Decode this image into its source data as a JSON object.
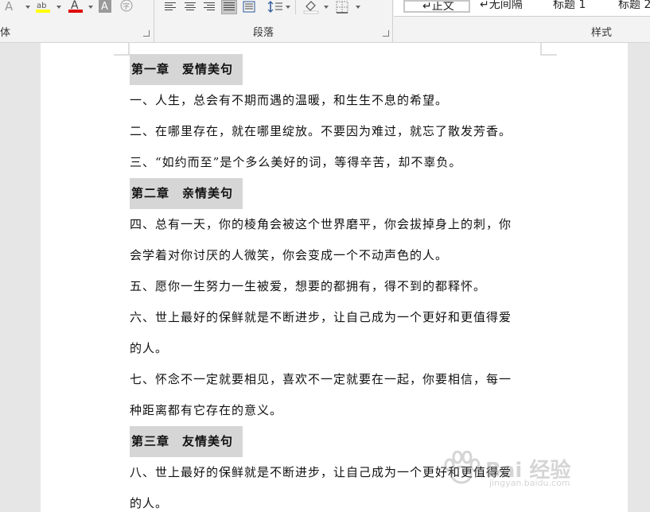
{
  "ribbon": {
    "font_group_label": "体",
    "paragraph_group_label": "段落",
    "styles_group_label": "样式",
    "styles": [
      {
        "label": "↵正文",
        "selected": true
      },
      {
        "label": "↵无间隔",
        "selected": false
      },
      {
        "label": "标题 1",
        "selected": false
      },
      {
        "label": "标题 2",
        "selected": false
      }
    ],
    "colors": {
      "highlight": "#ffff00",
      "font_color": "#e00000",
      "heading_shading": "#d6d6d6"
    }
  },
  "document": {
    "blocks": [
      {
        "type": "heading",
        "text": "第一章　爱情美句"
      },
      {
        "type": "para",
        "lines": [
          "一、人生，总会有不期而遇的温暖，和生生不息的希望。"
        ]
      },
      {
        "type": "para",
        "lines": [
          "二、在哪里存在，就在哪里绽放。不要因为难过，就忘了散发芳香。"
        ]
      },
      {
        "type": "para",
        "lines": [
          "三、“如约而至”是个多么美好的词，等得辛苦，却不辜负。"
        ]
      },
      {
        "type": "heading",
        "text": "第二章　亲情美句"
      },
      {
        "type": "para",
        "lines": [
          "四、总有一天，你的棱角会被这个世界磨平，你会拔掉身上的刺，你",
          "会学着对你讨厌的人微笑，你会变成一个不动声色的人。"
        ]
      },
      {
        "type": "para",
        "lines": [
          "五、愿你一生努力一生被爱，想要的都拥有，得不到的都释怀。"
        ]
      },
      {
        "type": "para",
        "lines": [
          "六、世上最好的保鲜就是不断进步，让自己成为一个更好和更值得爱",
          "的人。"
        ]
      },
      {
        "type": "para",
        "lines": [
          "七、怀念不一定就要相见，喜欢不一定就要在一起，你要相信，每一",
          "种距离都有它存在的意义。"
        ]
      },
      {
        "type": "heading",
        "text": "第三章　友情美句"
      },
      {
        "type": "para",
        "lines": [
          "八、世上最好的保鲜就是不断进步，让自己成为一个更好和更值得爱",
          "的人。"
        ]
      }
    ]
  },
  "watermark": {
    "text": "Bai 经验",
    "sub": "jingyan.baidu.com"
  }
}
